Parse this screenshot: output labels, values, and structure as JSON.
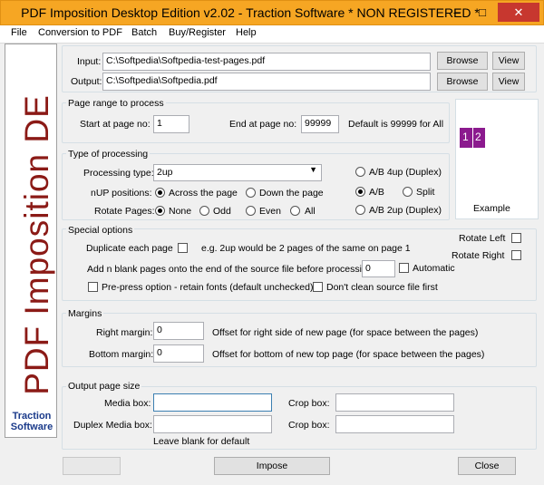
{
  "window": {
    "title": "PDF Imposition Desktop Edition v2.02 - Traction Software  * NON REGISTERED *",
    "minimize": "–",
    "maximize": "□",
    "close": "✕",
    "accent": "#f6a623"
  },
  "menu": {
    "items": [
      "File",
      "Conversion to PDF",
      "Batch",
      "Buy/Register",
      "Help"
    ]
  },
  "logo": {
    "text": "PDF Imposition DE",
    "brand_line1": "Traction",
    "brand_line2": "Software"
  },
  "io": {
    "input_label": "Input:",
    "input_value": "C:\\Softpedia\\Softpedia-test-pages.pdf",
    "output_label": "Output:",
    "output_value": "C:\\Softpedia\\Softpedia.pdf",
    "browse": "Browse",
    "view": "View"
  },
  "page_range": {
    "title": "Page range to process",
    "start_label": "Start at page no:",
    "start_value": "1",
    "end_label": "End at page no:",
    "end_value": "99999",
    "default_note": "Default is 99999 for All"
  },
  "example": {
    "page1": "1",
    "page2": "2",
    "label": "Example",
    "color": "#8b1a8e"
  },
  "processing": {
    "title": "Type of processing",
    "type_label": "Processing type:",
    "type_value": "2up",
    "nup_label": "nUP positions:",
    "nup_across": "Across the page",
    "nup_down": "Down the page",
    "rotate_label": "Rotate Pages:",
    "rot_none": "None",
    "rot_odd": "Odd",
    "rot_even": "Even",
    "rot_all": "All",
    "ab_4up": "A/B 4up (Duplex)",
    "ab": "A/B",
    "split": "Split",
    "ab_2up": "A/B 2up (Duplex)"
  },
  "special": {
    "title": "Special options",
    "duplicate_label": "Duplicate each page",
    "duplicate_note": "e.g. 2up would be 2 pages of the same on page 1",
    "rotate_left": "Rotate Left",
    "rotate_right": "Rotate Right",
    "blank_label": "Add n blank pages onto the end of the source file before processing:",
    "blank_value": "0",
    "automatic": "Automatic",
    "prepress": "Pre-press option - retain fonts (default unchecked)",
    "dont_clean": "Don't clean source file first"
  },
  "margins": {
    "title": "Margins",
    "right_label": "Right margin:",
    "right_value": "0",
    "right_note": "Offset for right side of new page (for space between the pages)",
    "bottom_label": "Bottom margin:",
    "bottom_value": "0",
    "bottom_note": "Offset for bottom of new top page (for space between the pages)"
  },
  "output_size": {
    "title": "Output page size",
    "media_label": "Media box:",
    "crop_label": "Crop box:",
    "duplex_label": "Duplex Media box:",
    "crop2_label": "Crop box:",
    "blank_note": "Leave blank for default"
  },
  "footer": {
    "impose": "Impose",
    "close": "Close"
  }
}
